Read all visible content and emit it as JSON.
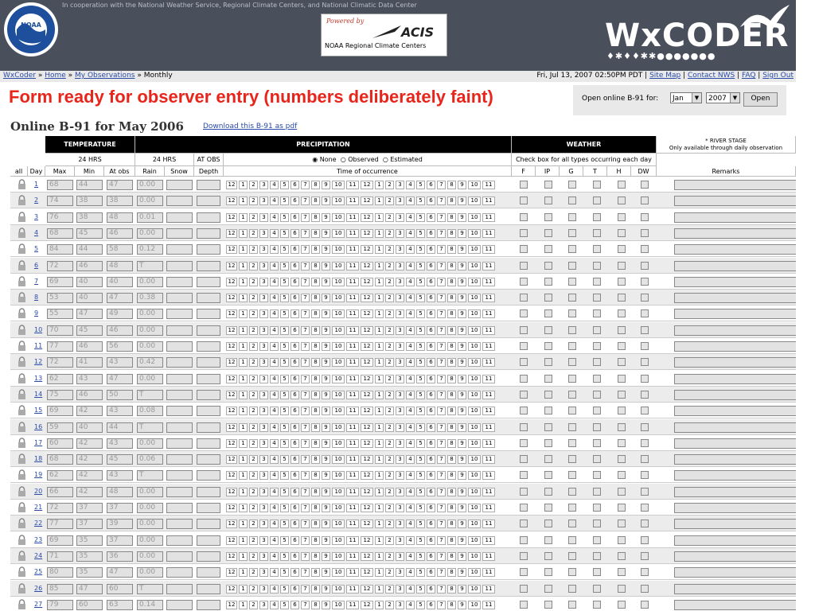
{
  "header": {
    "cooperation": "In cooperation with the National Weather Service, Regional Climate Centers, and National Climatic Data Center",
    "acis_powered": "Powered by",
    "acis_name": "ACIS",
    "acis_sub": "NOAA Regional Climate Centers",
    "wxcoder_logo": "WxCODER",
    "noaa_logo_text": "NOAA"
  },
  "nav": {
    "crumbs": [
      "WxCoder",
      "Home",
      "My Observations"
    ],
    "current": "Monthly",
    "datetime": "Fri, Jul 13, 2007 02:50PM PDT",
    "links": [
      "Site Map",
      "Contact NWS",
      "FAQ",
      "Sign Out"
    ]
  },
  "banner": "Form ready for observer entry (numbers deliberately faint)",
  "open_form": {
    "label": "Open online B-91 for:",
    "month": "Jan",
    "year": "2007",
    "button": "Open"
  },
  "form": {
    "title": "Online B-91 for May 2006",
    "pdf_link": "Download this B-91 as pdf"
  },
  "table": {
    "groups": {
      "temperature": "TEMPERATURE",
      "precipitation": "PRECIPITATION",
      "weather": "WEATHER"
    },
    "river_stage": "* RIVER STAGE",
    "river_stage_note": "Only available through daily observation",
    "hrs24_a": "24 HRS",
    "hrs24_b": "24 HRS",
    "at_obs": "AT OBS",
    "precip_options": [
      "None",
      "Observed",
      "Estimated"
    ],
    "weather_note": "Check box for all types occurring each day",
    "columns": {
      "all": "all",
      "day": "Day",
      "max": "Max",
      "min": "Min",
      "atobs": "At obs",
      "rain": "Rain",
      "snow": "Snow",
      "depth": "Depth",
      "time": "Time of occurrence",
      "remarks": "Remarks"
    },
    "weather_types": [
      "F",
      "IP",
      "G",
      "T",
      "H",
      "DW"
    ],
    "hours": [
      "12",
      "1",
      "2",
      "3",
      "4",
      "5",
      "6",
      "7",
      "8",
      "9",
      "10",
      "11",
      "12",
      "1",
      "2",
      "3",
      "4",
      "5",
      "6",
      "7",
      "8",
      "9",
      "10",
      "11"
    ],
    "rows": [
      {
        "day": "1",
        "max": "68",
        "min": "44",
        "atobs": "47",
        "rain": "0.00"
      },
      {
        "day": "2",
        "max": "74",
        "min": "38",
        "atobs": "38",
        "rain": "0.00"
      },
      {
        "day": "3",
        "max": "76",
        "min": "38",
        "atobs": "48",
        "rain": "0.01"
      },
      {
        "day": "4",
        "max": "68",
        "min": "45",
        "atobs": "46",
        "rain": "0.00"
      },
      {
        "day": "5",
        "max": "84",
        "min": "44",
        "atobs": "58",
        "rain": "0.12"
      },
      {
        "day": "6",
        "max": "72",
        "min": "46",
        "atobs": "48",
        "rain": "T"
      },
      {
        "day": "7",
        "max": "69",
        "min": "40",
        "atobs": "40",
        "rain": "0.00"
      },
      {
        "day": "8",
        "max": "53",
        "min": "40",
        "atobs": "47",
        "rain": "0.38"
      },
      {
        "day": "9",
        "max": "55",
        "min": "47",
        "atobs": "49",
        "rain": "0.00"
      },
      {
        "day": "10",
        "max": "70",
        "min": "45",
        "atobs": "46",
        "rain": "0.00"
      },
      {
        "day": "11",
        "max": "77",
        "min": "46",
        "atobs": "56",
        "rain": "0.00"
      },
      {
        "day": "12",
        "max": "72",
        "min": "41",
        "atobs": "43",
        "rain": "0.42"
      },
      {
        "day": "13",
        "max": "62",
        "min": "43",
        "atobs": "47",
        "rain": "0.00"
      },
      {
        "day": "14",
        "max": "75",
        "min": "46",
        "atobs": "50",
        "rain": "T"
      },
      {
        "day": "15",
        "max": "69",
        "min": "42",
        "atobs": "43",
        "rain": "0.08"
      },
      {
        "day": "16",
        "max": "59",
        "min": "40",
        "atobs": "44",
        "rain": "T"
      },
      {
        "day": "17",
        "max": "60",
        "min": "42",
        "atobs": "43",
        "rain": "0.00"
      },
      {
        "day": "18",
        "max": "68",
        "min": "42",
        "atobs": "45",
        "rain": "0.06"
      },
      {
        "day": "19",
        "max": "62",
        "min": "42",
        "atobs": "43",
        "rain": "T"
      },
      {
        "day": "20",
        "max": "66",
        "min": "42",
        "atobs": "48",
        "rain": "0.00"
      },
      {
        "day": "21",
        "max": "72",
        "min": "37",
        "atobs": "37",
        "rain": "0.00"
      },
      {
        "day": "22",
        "max": "77",
        "min": "37",
        "atobs": "39",
        "rain": "0.00"
      },
      {
        "day": "23",
        "max": "69",
        "min": "35",
        "atobs": "37",
        "rain": "0.00"
      },
      {
        "day": "24",
        "max": "71",
        "min": "35",
        "atobs": "36",
        "rain": "0.00"
      },
      {
        "day": "25",
        "max": "80",
        "min": "35",
        "atobs": "47",
        "rain": "0.00"
      },
      {
        "day": "26",
        "max": "85",
        "min": "47",
        "atobs": "60",
        "rain": "T"
      },
      {
        "day": "27",
        "max": "79",
        "min": "60",
        "atobs": "63",
        "rain": "0.14"
      }
    ]
  }
}
